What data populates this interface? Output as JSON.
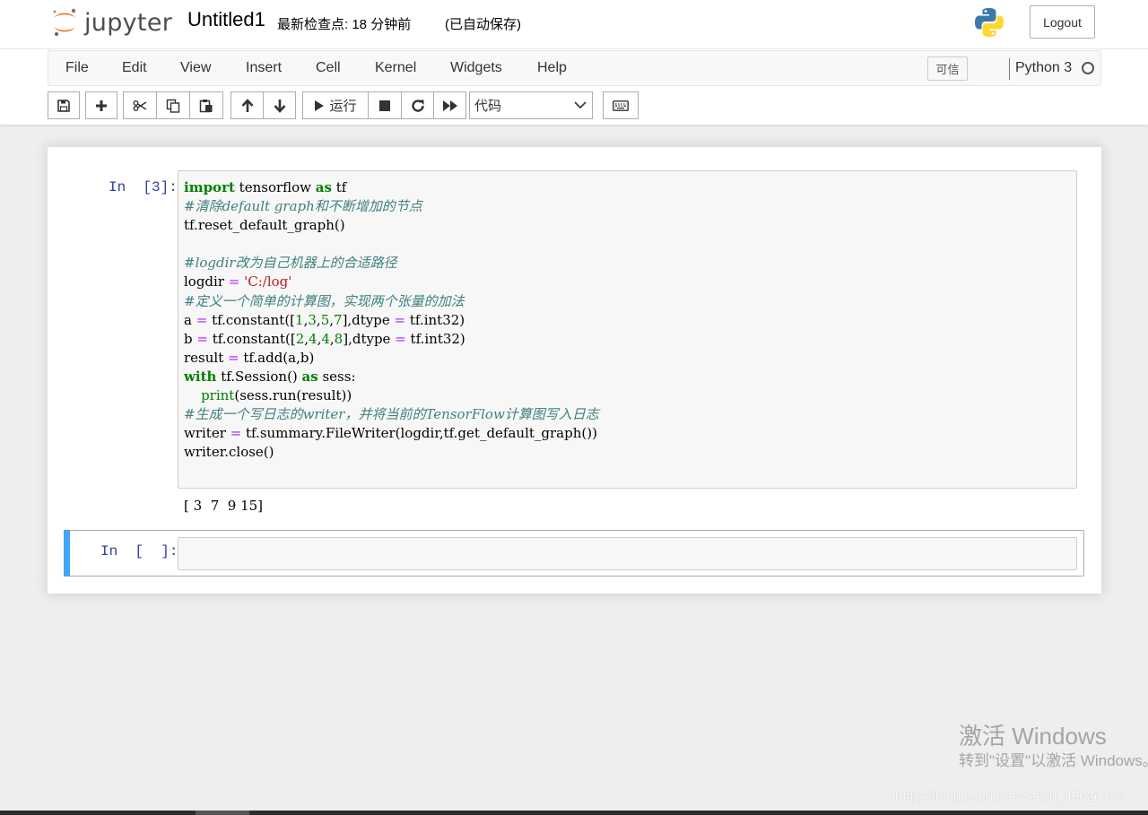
{
  "header": {
    "logo_text": "jupyter",
    "notebook_name": "Untitled1",
    "checkpoint": "最新检查点: 18 分钟前",
    "autosave": "(已自动保存)",
    "logout_label": "Logout"
  },
  "menubar": {
    "items": [
      "File",
      "Edit",
      "View",
      "Insert",
      "Cell",
      "Kernel",
      "Widgets",
      "Help"
    ],
    "trusted_label": "可信",
    "kernel_name": "Python 3"
  },
  "toolbar": {
    "run_label": "运行",
    "cell_type": "代码",
    "icons": [
      "save-icon",
      "plus-icon",
      "cut-icon",
      "copy-icon",
      "paste-icon",
      "arrow-up-icon",
      "arrow-down-icon",
      "play-icon",
      "stop-icon",
      "restart-icon",
      "fast-forward-icon",
      "keyboard-icon"
    ]
  },
  "cells": [
    {
      "prompt": "In  [3]:",
      "code_lines": [
        "import tensorflow as tf",
        "#清除default graph和不断增加的节点",
        "tf.reset_default_graph()",
        "",
        "#logdir改为自己机器上的合适路径",
        "logdir = 'C:/log'",
        "#定义一个简单的计算图，实现两个张量的加法",
        "a = tf.constant([1,3,5,7],dtype = tf.int32)",
        "b = tf.constant([2,4,4,8],dtype = tf.int32)",
        "result = tf.add(a,b)",
        "with tf.Session() as sess:",
        "    print(sess.run(result))",
        "#生成一个写日志的writer，并将当前的TensorFlow计算图写入日志",
        "writer = tf.summary.FileWriter(logdir,tf.get_default_graph())",
        "writer.close()"
      ],
      "output": "[ 3  7  9 15]"
    },
    {
      "prompt": "In  [  ]:"
    }
  ],
  "watermark": {
    "activate_title": "激活 Windows",
    "activate_sub": "转到\"设置\"以激活 Windows。",
    "csdn": "https://blog.csdn.net/weixin_45626468"
  },
  "colors": {
    "prompt": "#303f9f",
    "keyword": "#008000",
    "comment": "#408080",
    "string": "#ba2121",
    "operator": "#aa22ff",
    "selected_cell_bar": "#42a5f5"
  }
}
